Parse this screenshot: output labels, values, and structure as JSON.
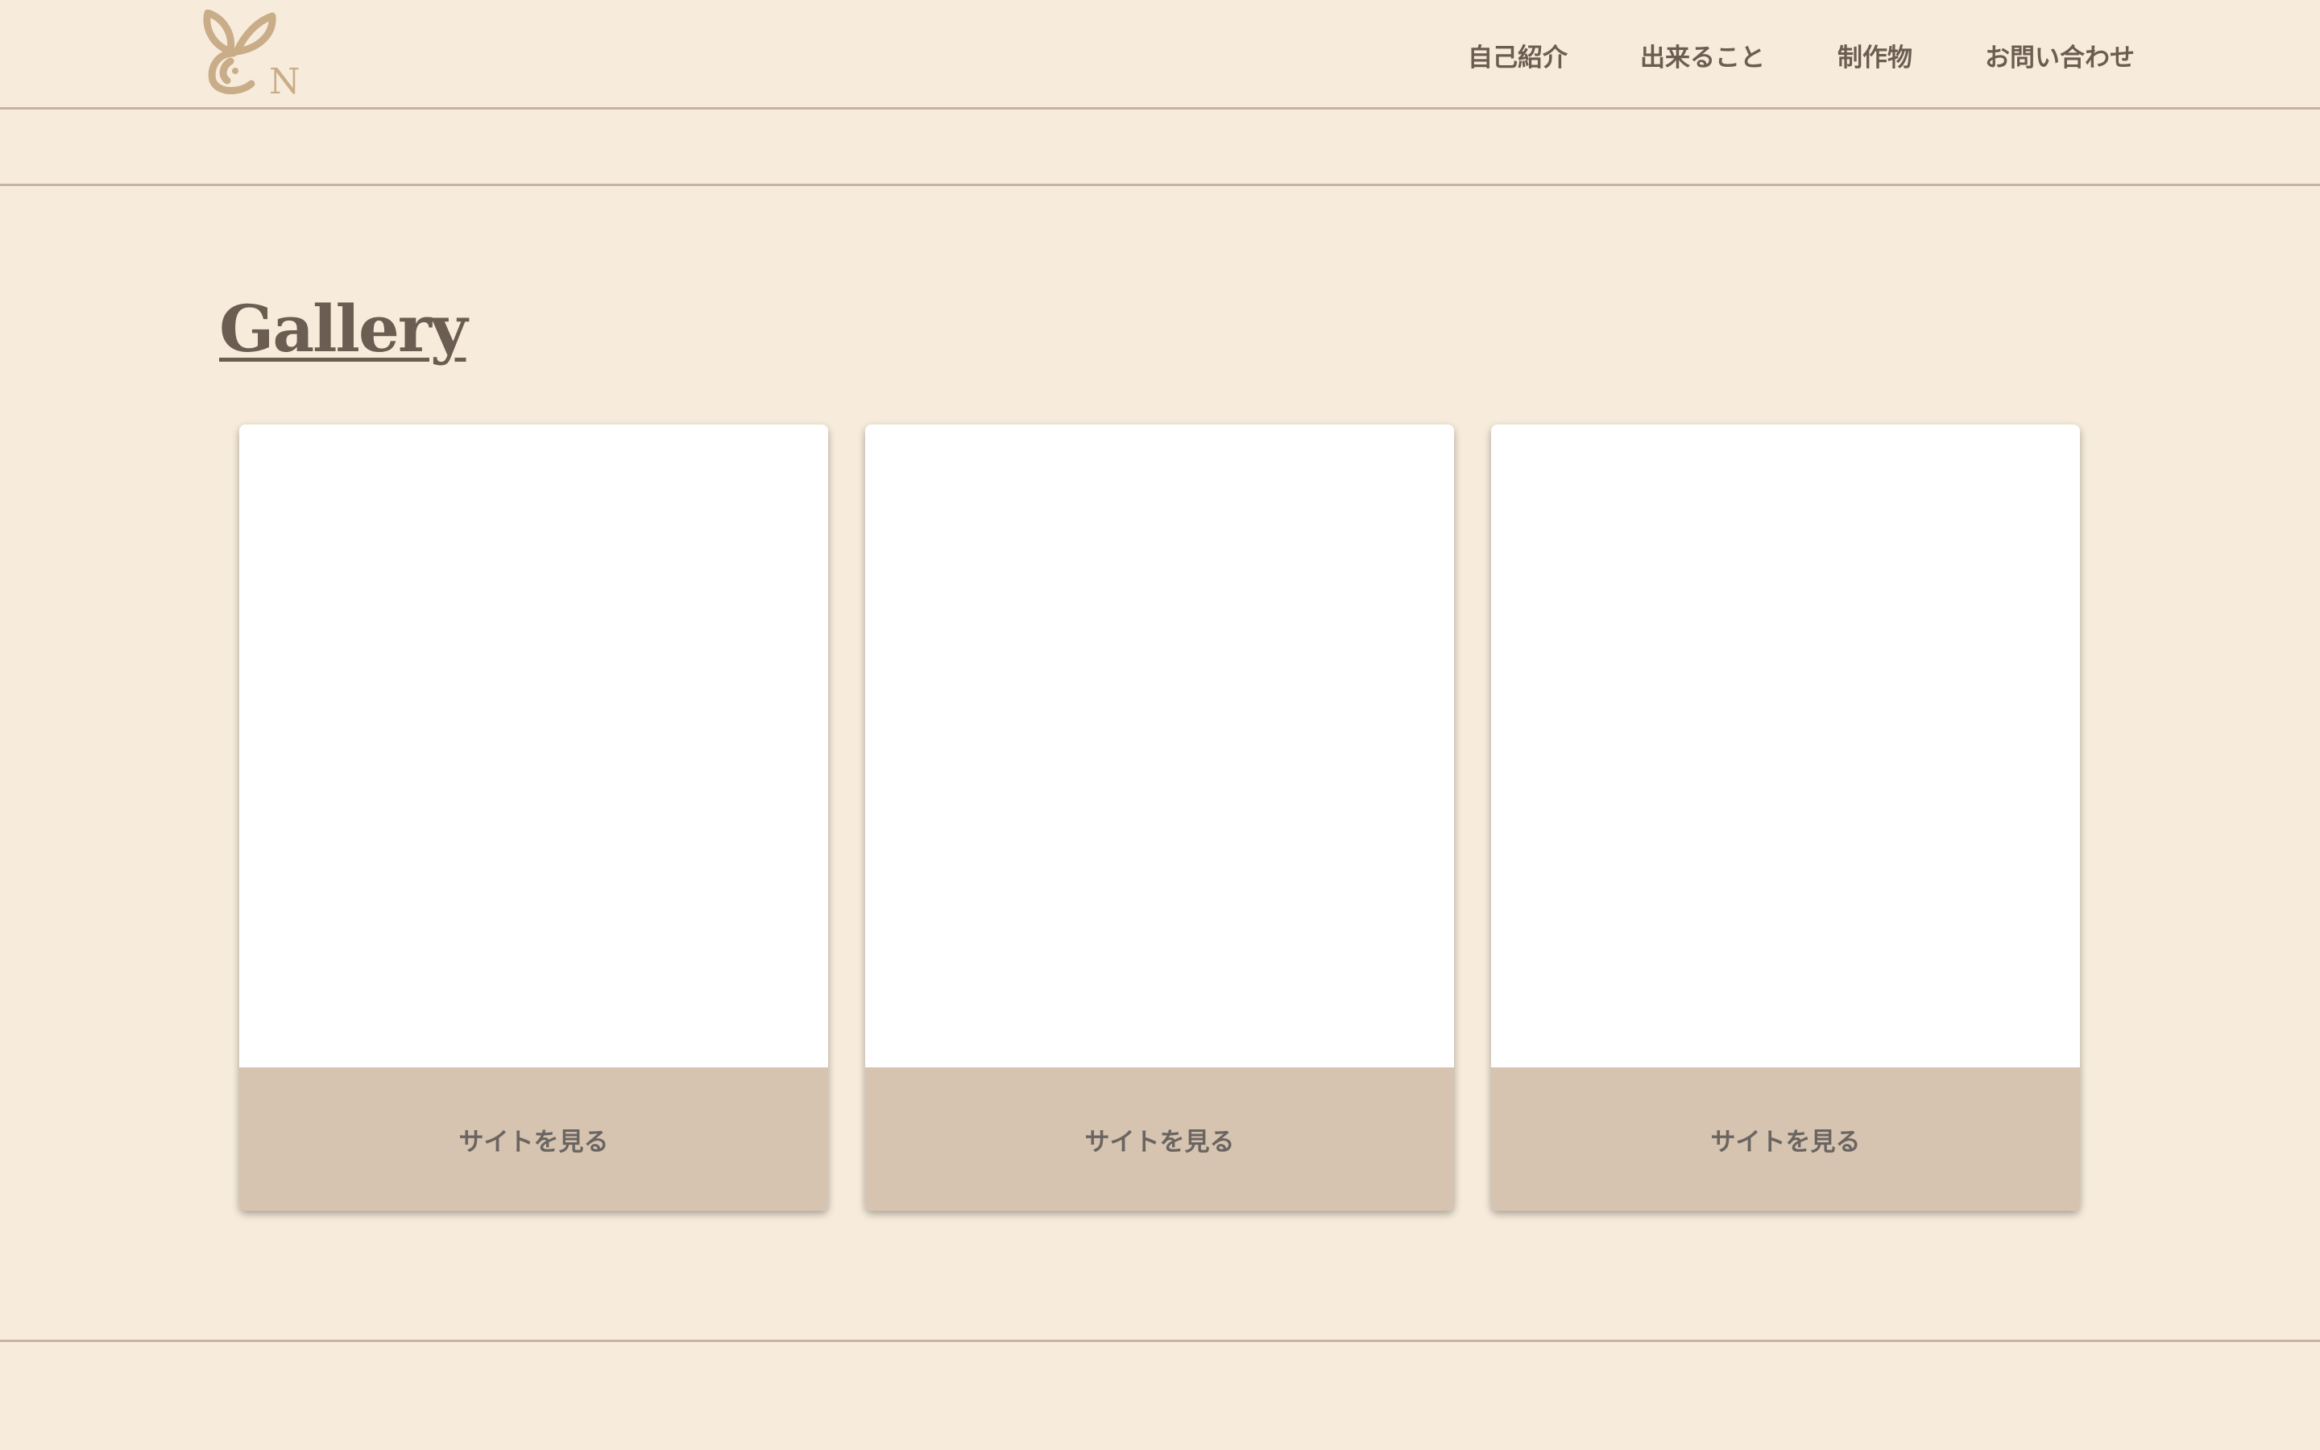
{
  "header": {
    "logo_icon": "leaf-monogram-logo",
    "logo_letter": "N",
    "nav": [
      {
        "label": "自己紹介"
      },
      {
        "label": "出来ること"
      },
      {
        "label": "制作物"
      },
      {
        "label": "お問い合わせ"
      }
    ]
  },
  "gallery": {
    "title": "Gallery",
    "cards": [
      {
        "button_label": "サイトを見る"
      },
      {
        "button_label": "サイトを見る"
      },
      {
        "button_label": "サイトを見る"
      }
    ]
  },
  "colors": {
    "background": "#f7ecdc",
    "accent": "#d6c4b1",
    "line": "#c7b3a1",
    "text": "#6b5d51",
    "logo": "#c9ad88"
  }
}
